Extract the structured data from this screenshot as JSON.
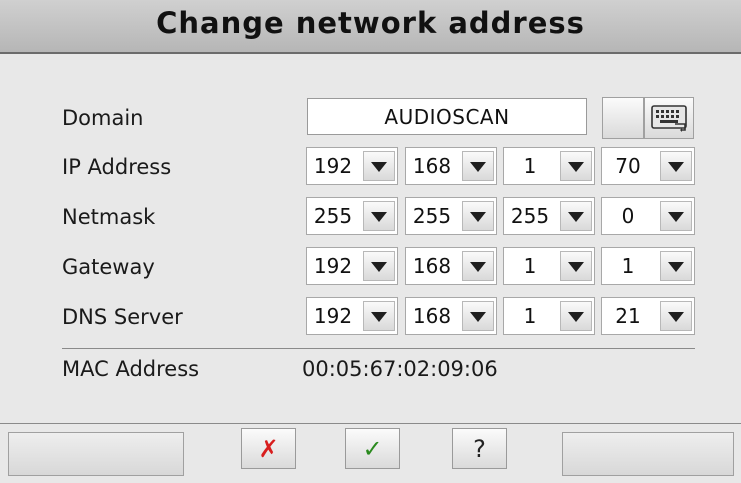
{
  "dialog": {
    "title": "Change network address"
  },
  "domain": {
    "label": "Domain",
    "value": "AUDIOSCAN"
  },
  "rows": [
    {
      "label": "IP Address",
      "octets": [
        "192",
        "168",
        "1",
        "70"
      ]
    },
    {
      "label": "Netmask",
      "octets": [
        "255",
        "255",
        "255",
        "0"
      ]
    },
    {
      "label": "Gateway",
      "octets": [
        "192",
        "168",
        "1",
        "1"
      ]
    },
    {
      "label": "DNS Server",
      "octets": [
        "192",
        "168",
        "1",
        "21"
      ]
    }
  ],
  "mac": {
    "label": "MAC Address",
    "value": "00:05:67:02:09:06"
  },
  "actions": {
    "cancel_glyph": "✗",
    "ok_glyph": "✓",
    "help_glyph": "?"
  },
  "icons": {
    "dropdown": "triangle-down-icon",
    "keyboard": "keyboard-icon"
  },
  "colors": {
    "cancel": "#d81e1e",
    "ok": "#2a8a1e",
    "title_bar": "#c4c4c4"
  }
}
